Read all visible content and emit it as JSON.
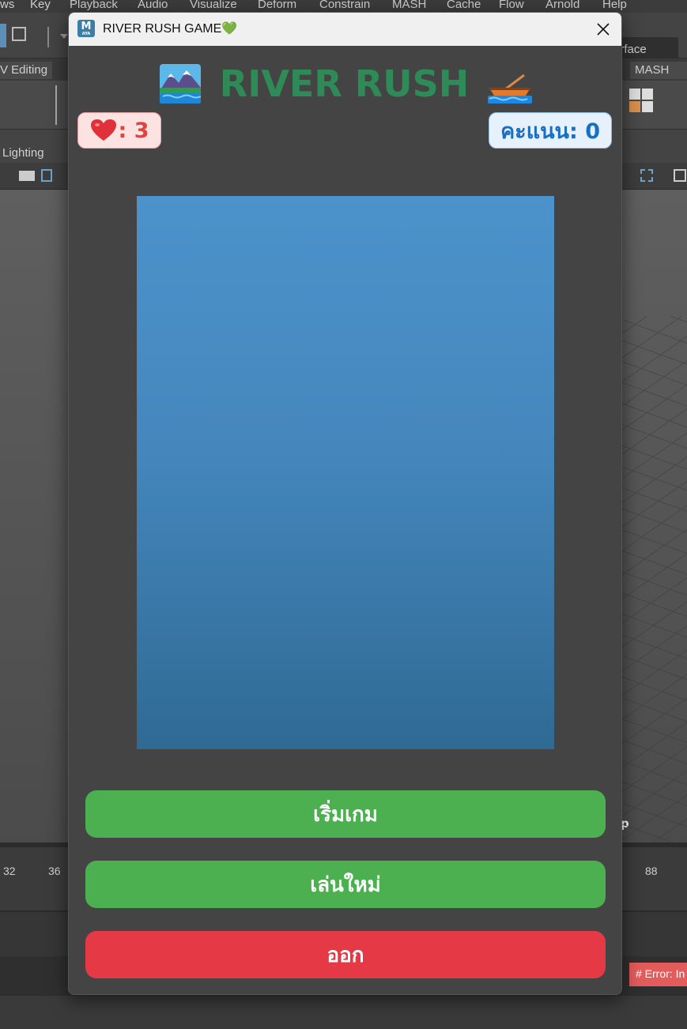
{
  "host": {
    "menu": [
      "ws",
      "Key",
      "Playback",
      "Audio",
      "Visualize",
      "Deform",
      "Constrain",
      "MASH",
      "Cache",
      "Flow",
      "Arnold",
      "Help"
    ],
    "surface_field": "urface",
    "shelf_tabs": {
      "uv_editing": "V Editing",
      "mash": "MASH"
    },
    "panel_menu": {
      "lighting": "Lighting"
    },
    "time_frames": {
      "f32": "32",
      "f36": "36",
      "f88": "88"
    },
    "error_text": "# Error: In",
    "viewport_label": "p"
  },
  "window": {
    "title": "RIVER RUSH GAME💚",
    "icon_letter": "M",
    "icon_sub": "AYA"
  },
  "game": {
    "title": "RIVER RUSH",
    "lives_text": ": 3",
    "score_text": "คะแนน: 0"
  },
  "buttons": {
    "start": "เริ่มเกม",
    "restart": "เล่นใหม่",
    "exit": "ออก"
  },
  "colors": {
    "title_green": "#2e8b57",
    "button_green": "#4caf50",
    "button_red": "#e63946",
    "river_top": "#4c93cb",
    "river_bottom": "#2f6a94"
  }
}
